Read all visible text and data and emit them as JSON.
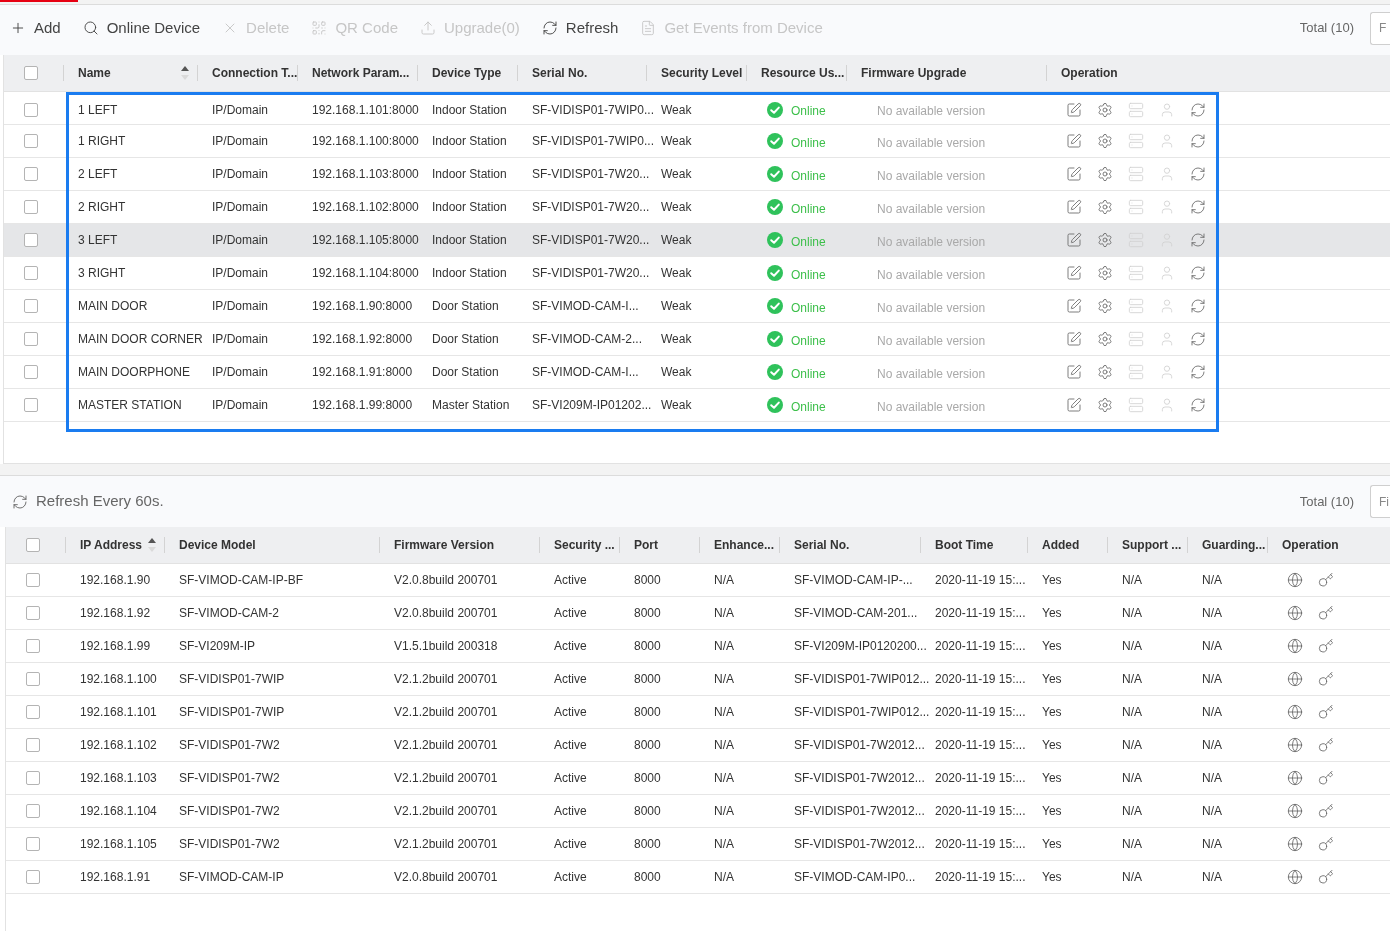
{
  "device_list": {
    "toolbar": [
      {
        "kind": "add",
        "label": "Add",
        "disabled": false
      },
      {
        "kind": "search",
        "label": "Online Device",
        "disabled": false
      },
      {
        "kind": "delete",
        "label": "Delete",
        "disabled": true
      },
      {
        "kind": "qr",
        "label": "QR Code",
        "disabled": true
      },
      {
        "kind": "upload",
        "label": "Upgrade(0)",
        "disabled": true
      },
      {
        "kind": "refresh",
        "label": "Refresh",
        "disabled": false
      },
      {
        "kind": "document",
        "label": "Get Events from Device",
        "disabled": true
      }
    ],
    "total": "Total (10)",
    "filter": {
      "placeholder": "F"
    },
    "selection_frame": true,
    "table": {
      "header_checkbox": {
        "checked": false
      },
      "columns": [
        {
          "label": "Name",
          "sort_ascending": true
        },
        {
          "label": "Connection T..."
        },
        {
          "label": "Network Param..."
        },
        {
          "label": "Device Type"
        },
        {
          "label": "Serial No."
        },
        {
          "label": "Security Level"
        },
        {
          "label": "Resource Us..."
        },
        {
          "label": "Firmware Upgrade"
        },
        {
          "label": "Operation"
        }
      ],
      "row_operations": [
        {
          "kind": "edit",
          "disabled": false
        },
        {
          "kind": "settings",
          "disabled": false
        },
        {
          "kind": "server",
          "disabled": true
        },
        {
          "kind": "user",
          "disabled": true
        },
        {
          "kind": "refresh",
          "disabled": false
        }
      ],
      "rows": [
        {
          "checked": false,
          "selected": false,
          "cells": [
            "1 LEFT",
            "IP/Domain",
            "192.168.1.101:8000",
            "Indoor Station",
            "SF-VIDISP01-7WIP0...",
            "Weak"
          ],
          "status": {
            "kind": "online",
            "label": "Online"
          },
          "firmware_upgrade": "No available version"
        },
        {
          "checked": false,
          "selected": false,
          "cells": [
            "1 RIGHT",
            "IP/Domain",
            "192.168.1.100:8000",
            "Indoor Station",
            "SF-VIDISP01-7WIP0...",
            "Weak"
          ],
          "status": {
            "kind": "online",
            "label": "Online"
          },
          "firmware_upgrade": "No available version"
        },
        {
          "checked": false,
          "selected": false,
          "cells": [
            "2 LEFT",
            "IP/Domain",
            "192.168.1.103:8000",
            "Indoor Station",
            "SF-VIDISP01-7W20...",
            "Weak"
          ],
          "status": {
            "kind": "online",
            "label": "Online"
          },
          "firmware_upgrade": "No available version"
        },
        {
          "checked": false,
          "selected": false,
          "cells": [
            "2 RIGHT",
            "IP/Domain",
            "192.168.1.102:8000",
            "Indoor Station",
            "SF-VIDISP01-7W20...",
            "Weak"
          ],
          "status": {
            "kind": "online",
            "label": "Online"
          },
          "firmware_upgrade": "No available version"
        },
        {
          "checked": false,
          "selected": true,
          "cells": [
            "3 LEFT",
            "IP/Domain",
            "192.168.1.105:8000",
            "Indoor Station",
            "SF-VIDISP01-7W20...",
            "Weak"
          ],
          "status": {
            "kind": "online",
            "label": "Online"
          },
          "firmware_upgrade": "No available version"
        },
        {
          "checked": false,
          "selected": false,
          "cells": [
            "3 RIGHT",
            "IP/Domain",
            "192.168.1.104:8000",
            "Indoor Station",
            "SF-VIDISP01-7W20...",
            "Weak"
          ],
          "status": {
            "kind": "online",
            "label": "Online"
          },
          "firmware_upgrade": "No available version"
        },
        {
          "checked": false,
          "selected": false,
          "cells": [
            "MAIN DOOR",
            "IP/Domain",
            "192.168.1.90:8000",
            "Door Station",
            "SF-VIMOD-CAM-I...",
            "Weak"
          ],
          "status": {
            "kind": "online",
            "label": "Online"
          },
          "firmware_upgrade": "No available version"
        },
        {
          "checked": false,
          "selected": false,
          "cells": [
            "MAIN DOOR CORNER",
            "IP/Domain",
            "192.168.1.92:8000",
            "Door Station",
            "SF-VIMOD-CAM-2...",
            "Weak"
          ],
          "status": {
            "kind": "online",
            "label": "Online"
          },
          "firmware_upgrade": "No available version"
        },
        {
          "checked": false,
          "selected": false,
          "cells": [
            "MAIN DOORPHONE",
            "IP/Domain",
            "192.168.1.91:8000",
            "Door Station",
            "SF-VIMOD-CAM-I...",
            "Weak"
          ],
          "status": {
            "kind": "online",
            "label": "Online"
          },
          "firmware_upgrade": "No available version"
        },
        {
          "checked": false,
          "selected": false,
          "cells": [
            "MASTER STATION",
            "IP/Domain",
            "192.168.1.99:8000",
            "Master Station",
            "SF-VI209M-IP01202...",
            "Weak"
          ],
          "status": {
            "kind": "online",
            "label": "Online"
          },
          "firmware_upgrade": "No available version"
        }
      ]
    }
  },
  "online_devices": {
    "refresh_note": "Refresh Every 60s.",
    "total": "Total (10)",
    "filter": {
      "placeholder": "Fi"
    },
    "table": {
      "header_checkbox": {
        "checked": false
      },
      "columns": [
        {
          "label": "IP Address",
          "sort_ascending": true
        },
        {
          "label": "Device Model"
        },
        {
          "label": "Firmware Version"
        },
        {
          "label": "Security ..."
        },
        {
          "label": "Port"
        },
        {
          "label": "Enhance..."
        },
        {
          "label": "Serial No."
        },
        {
          "label": "Boot Time"
        },
        {
          "label": "Added"
        },
        {
          "label": "Support ..."
        },
        {
          "label": "Guarding..."
        },
        {
          "label": "Operation"
        }
      ],
      "row_operations": [
        {
          "kind": "globe",
          "disabled": false
        },
        {
          "kind": "key",
          "disabled": false
        }
      ],
      "rows": [
        {
          "checked": false,
          "cells": [
            "192.168.1.90",
            "SF-VIMOD-CAM-IP-BF",
            "V2.0.8build 200701",
            "Active",
            "8000",
            "N/A",
            "SF-VIMOD-CAM-IP-...",
            "2020-11-19 15:...",
            "Yes",
            "N/A",
            "N/A"
          ]
        },
        {
          "checked": false,
          "cells": [
            "192.168.1.92",
            "SF-VIMOD-CAM-2",
            "V2.0.8build 200701",
            "Active",
            "8000",
            "N/A",
            "SF-VIMOD-CAM-201...",
            "2020-11-19 15:...",
            "Yes",
            "N/A",
            "N/A"
          ]
        },
        {
          "checked": false,
          "cells": [
            "192.168.1.99",
            "SF-VI209M-IP",
            "V1.5.1build 200318",
            "Active",
            "8000",
            "N/A",
            "SF-VI209M-IP0120200...",
            "2020-11-19 15:...",
            "Yes",
            "N/A",
            "N/A"
          ]
        },
        {
          "checked": false,
          "cells": [
            "192.168.1.100",
            "SF-VIDISP01-7WIP",
            "V2.1.2build 200701",
            "Active",
            "8000",
            "N/A",
            "SF-VIDISP01-7WIP012...",
            "2020-11-19 15:...",
            "Yes",
            "N/A",
            "N/A"
          ]
        },
        {
          "checked": false,
          "cells": [
            "192.168.1.101",
            "SF-VIDISP01-7WIP",
            "V2.1.2build 200701",
            "Active",
            "8000",
            "N/A",
            "SF-VIDISP01-7WIP012...",
            "2020-11-19 15:...",
            "Yes",
            "N/A",
            "N/A"
          ]
        },
        {
          "checked": false,
          "cells": [
            "192.168.1.102",
            "SF-VIDISP01-7W2",
            "V2.1.2build 200701",
            "Active",
            "8000",
            "N/A",
            "SF-VIDISP01-7W2012...",
            "2020-11-19 15:...",
            "Yes",
            "N/A",
            "N/A"
          ]
        },
        {
          "checked": false,
          "cells": [
            "192.168.1.103",
            "SF-VIDISP01-7W2",
            "V2.1.2build 200701",
            "Active",
            "8000",
            "N/A",
            "SF-VIDISP01-7W2012...",
            "2020-11-19 15:...",
            "Yes",
            "N/A",
            "N/A"
          ]
        },
        {
          "checked": false,
          "cells": [
            "192.168.1.104",
            "SF-VIDISP01-7W2",
            "V2.1.2build 200701",
            "Active",
            "8000",
            "N/A",
            "SF-VIDISP01-7W2012...",
            "2020-11-19 15:...",
            "Yes",
            "N/A",
            "N/A"
          ]
        },
        {
          "checked": false,
          "cells": [
            "192.168.1.105",
            "SF-VIDISP01-7W2",
            "V2.1.2build 200701",
            "Active",
            "8000",
            "N/A",
            "SF-VIDISP01-7W2012...",
            "2020-11-19 15:...",
            "Yes",
            "N/A",
            "N/A"
          ]
        },
        {
          "checked": false,
          "cells": [
            "192.168.1.91",
            "SF-VIMOD-CAM-IP",
            "V2.0.8build 200701",
            "Active",
            "8000",
            "N/A",
            "SF-VIMOD-CAM-IP0...",
            "2020-11-19 15:...",
            "Yes",
            "N/A",
            "N/A"
          ]
        }
      ]
    }
  }
}
